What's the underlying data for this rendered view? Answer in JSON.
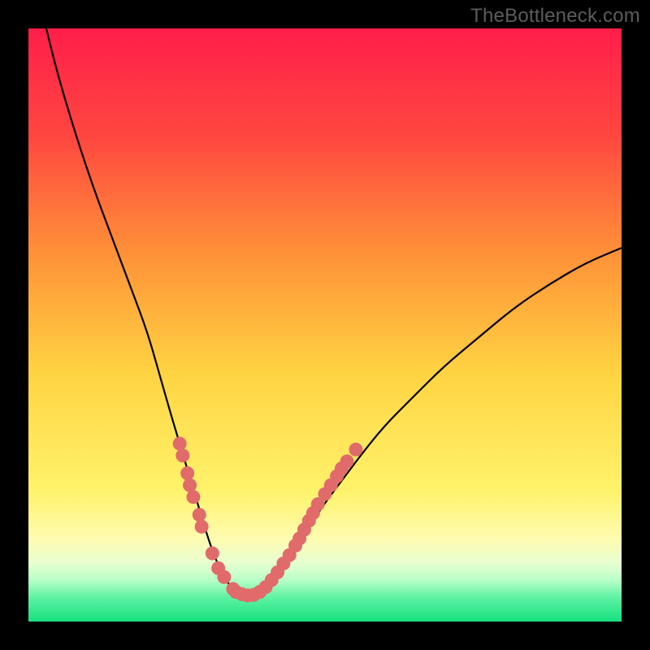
{
  "watermark": "TheBottleneck.com",
  "colors": {
    "frame": "#000000",
    "gradient_top": "#ff1e4a",
    "gradient_mid1": "#ff6a3a",
    "gradient_mid2": "#ffd342",
    "gradient_low": "#fffbb0",
    "gradient_band_pale": "#e9ffd0",
    "gradient_band_green": "#2fe889",
    "curve_stroke": "#000000",
    "dot_fill": "#e16a6a"
  },
  "chart_data": {
    "type": "line",
    "title": "",
    "xlabel": "",
    "ylabel": "",
    "xlim": [
      0,
      100
    ],
    "ylim": [
      0,
      100
    ],
    "series": [
      {
        "name": "bottleneck-curve",
        "x": [
          3,
          5,
          8,
          11,
          14,
          17,
          20,
          22,
          24,
          25.5,
          27,
          28.5,
          30,
          31,
          32,
          33,
          34,
          35,
          36,
          37,
          38,
          39,
          40,
          42,
          44,
          46,
          48,
          50,
          53,
          56,
          60,
          65,
          70,
          76,
          82,
          88,
          94,
          100
        ],
        "y": [
          100,
          92,
          82,
          73,
          65,
          57,
          49,
          42,
          35,
          30,
          25,
          20,
          15,
          12,
          9.5,
          7.5,
          6,
          5,
          4.5,
          4.3,
          4.5,
          5,
          6,
          8,
          11,
          14,
          17,
          20,
          24,
          28,
          33,
          38,
          43,
          48,
          53,
          57,
          60.5,
          63
        ]
      }
    ],
    "dot_clusters": [
      {
        "name": "left-cluster",
        "points": [
          {
            "x": 25.5,
            "y": 30
          },
          {
            "x": 26.0,
            "y": 28
          },
          {
            "x": 26.8,
            "y": 25
          },
          {
            "x": 27.2,
            "y": 23
          },
          {
            "x": 27.8,
            "y": 21
          },
          {
            "x": 28.8,
            "y": 18
          },
          {
            "x": 29.2,
            "y": 16
          },
          {
            "x": 31.0,
            "y": 11.5
          },
          {
            "x": 32.0,
            "y": 9
          },
          {
            "x": 33.0,
            "y": 7.5
          },
          {
            "x": 34.5,
            "y": 5.5
          },
          {
            "x": 35.0,
            "y": 5
          },
          {
            "x": 36.0,
            "y": 4.6
          },
          {
            "x": 37.0,
            "y": 4.4
          },
          {
            "x": 38.0,
            "y": 4.5
          },
          {
            "x": 39.0,
            "y": 5
          },
          {
            "x": 40.0,
            "y": 5.8
          }
        ]
      },
      {
        "name": "right-cluster",
        "points": [
          {
            "x": 41.0,
            "y": 7
          },
          {
            "x": 42.0,
            "y": 8.3
          },
          {
            "x": 43.0,
            "y": 9.8
          },
          {
            "x": 44.0,
            "y": 11.2
          },
          {
            "x": 45.0,
            "y": 12.8
          },
          {
            "x": 45.7,
            "y": 14
          },
          {
            "x": 46.5,
            "y": 15.5
          },
          {
            "x": 47.3,
            "y": 17
          },
          {
            "x": 48.0,
            "y": 18.3
          },
          {
            "x": 48.8,
            "y": 19.8
          },
          {
            "x": 50.0,
            "y": 21.5
          },
          {
            "x": 51.0,
            "y": 23
          },
          {
            "x": 52.0,
            "y": 24.5
          },
          {
            "x": 52.8,
            "y": 25.8
          },
          {
            "x": 53.7,
            "y": 27
          },
          {
            "x": 55.2,
            "y": 29
          }
        ]
      }
    ],
    "gradient_stops": [
      {
        "offset": 0,
        "color": "#ff1e4a"
      },
      {
        "offset": 18,
        "color": "#ff4640"
      },
      {
        "offset": 38,
        "color": "#ff9138"
      },
      {
        "offset": 58,
        "color": "#ffd342"
      },
      {
        "offset": 78,
        "color": "#fff36b"
      },
      {
        "offset": 86,
        "color": "#fffbb0"
      },
      {
        "offset": 90,
        "color": "#e9ffd0"
      },
      {
        "offset": 93,
        "color": "#b8ffc8"
      },
      {
        "offset": 96,
        "color": "#5cf2a3"
      },
      {
        "offset": 100,
        "color": "#17e07f"
      }
    ]
  }
}
